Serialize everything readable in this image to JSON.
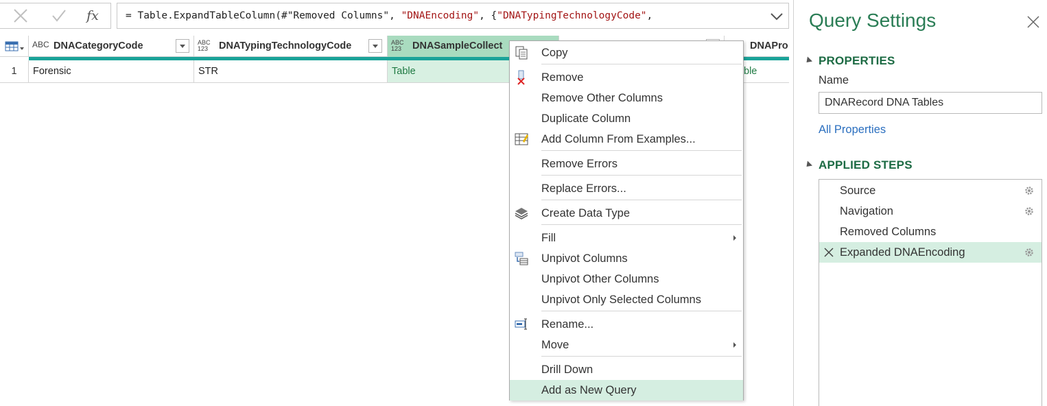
{
  "formula_bar": {
    "cancel_icon": "x-icon",
    "commit_icon": "check-icon",
    "fx_label": "fx",
    "formula_parts": [
      {
        "text": "= Table.ExpandTableColumn(#\"Removed Columns\", ",
        "kind": "plain"
      },
      {
        "text": "\"DNAEncoding\"",
        "kind": "string"
      },
      {
        "text": ", {",
        "kind": "plain"
      },
      {
        "text": "\"DNATypingTechnologyCode\"",
        "kind": "string"
      },
      {
        "text": ",",
        "kind": "plain"
      }
    ]
  },
  "grid": {
    "columns": [
      {
        "type_label": "ABC",
        "name": "DNACategoryCode",
        "selected": false
      },
      {
        "type_label": "ABC 123",
        "name": "DNATypingTechnologyCode",
        "selected": false
      },
      {
        "type_label": "ABC 123",
        "name": "DNASampleCollect",
        "selected": true
      },
      {
        "type_label": "",
        "name": "",
        "selected": false
      },
      {
        "type_label": "",
        "name": "DNAPro",
        "selected": false
      }
    ],
    "rows": [
      {
        "number": "1",
        "cells": [
          "Forensic",
          "STR",
          "Table",
          "",
          "ble"
        ]
      }
    ]
  },
  "context_menu": {
    "items": [
      {
        "label": "Copy",
        "icon": "copy-icon"
      },
      {
        "label": "Remove",
        "icon": "remove-column-icon"
      },
      {
        "label": "Remove Other Columns",
        "icon": ""
      },
      {
        "label": "Duplicate Column",
        "icon": ""
      },
      {
        "label": "Add Column From Examples...",
        "icon": "column-from-examples-icon"
      },
      {
        "label": "Remove Errors",
        "icon": ""
      },
      {
        "label": "Replace Errors...",
        "icon": ""
      },
      {
        "label": "Create Data Type",
        "icon": "data-type-icon"
      },
      {
        "label": "Fill",
        "icon": "",
        "submenu": true
      },
      {
        "label": "Unpivot Columns",
        "icon": "unpivot-icon"
      },
      {
        "label": "Unpivot Other Columns",
        "icon": ""
      },
      {
        "label": "Unpivot Only Selected Columns",
        "icon": ""
      },
      {
        "label": "Rename...",
        "icon": "rename-icon"
      },
      {
        "label": "Move",
        "icon": "",
        "submenu": true
      },
      {
        "label": "Drill Down",
        "icon": ""
      },
      {
        "label": "Add as New Query",
        "icon": "",
        "hovered": true
      }
    ]
  },
  "query_settings": {
    "title": "Query Settings",
    "properties_header": "PROPERTIES",
    "name_label": "Name",
    "name_value": "DNARecord DNA Tables",
    "all_properties_link": "All Properties",
    "applied_steps_header": "APPLIED STEPS",
    "steps": [
      {
        "label": "Source",
        "has_gear": true,
        "active": false
      },
      {
        "label": "Navigation",
        "has_gear": true,
        "active": false
      },
      {
        "label": "Removed Columns",
        "has_gear": false,
        "active": false
      },
      {
        "label": "Expanded DNAEncoding",
        "has_gear": true,
        "active": true
      }
    ]
  },
  "colors": {
    "accent_green": "#2a7d55",
    "selected_column": "#a9dbbf",
    "quality_bar": "#1aa399",
    "hover": "#d5eee1",
    "link_blue": "#2b6fbf"
  }
}
